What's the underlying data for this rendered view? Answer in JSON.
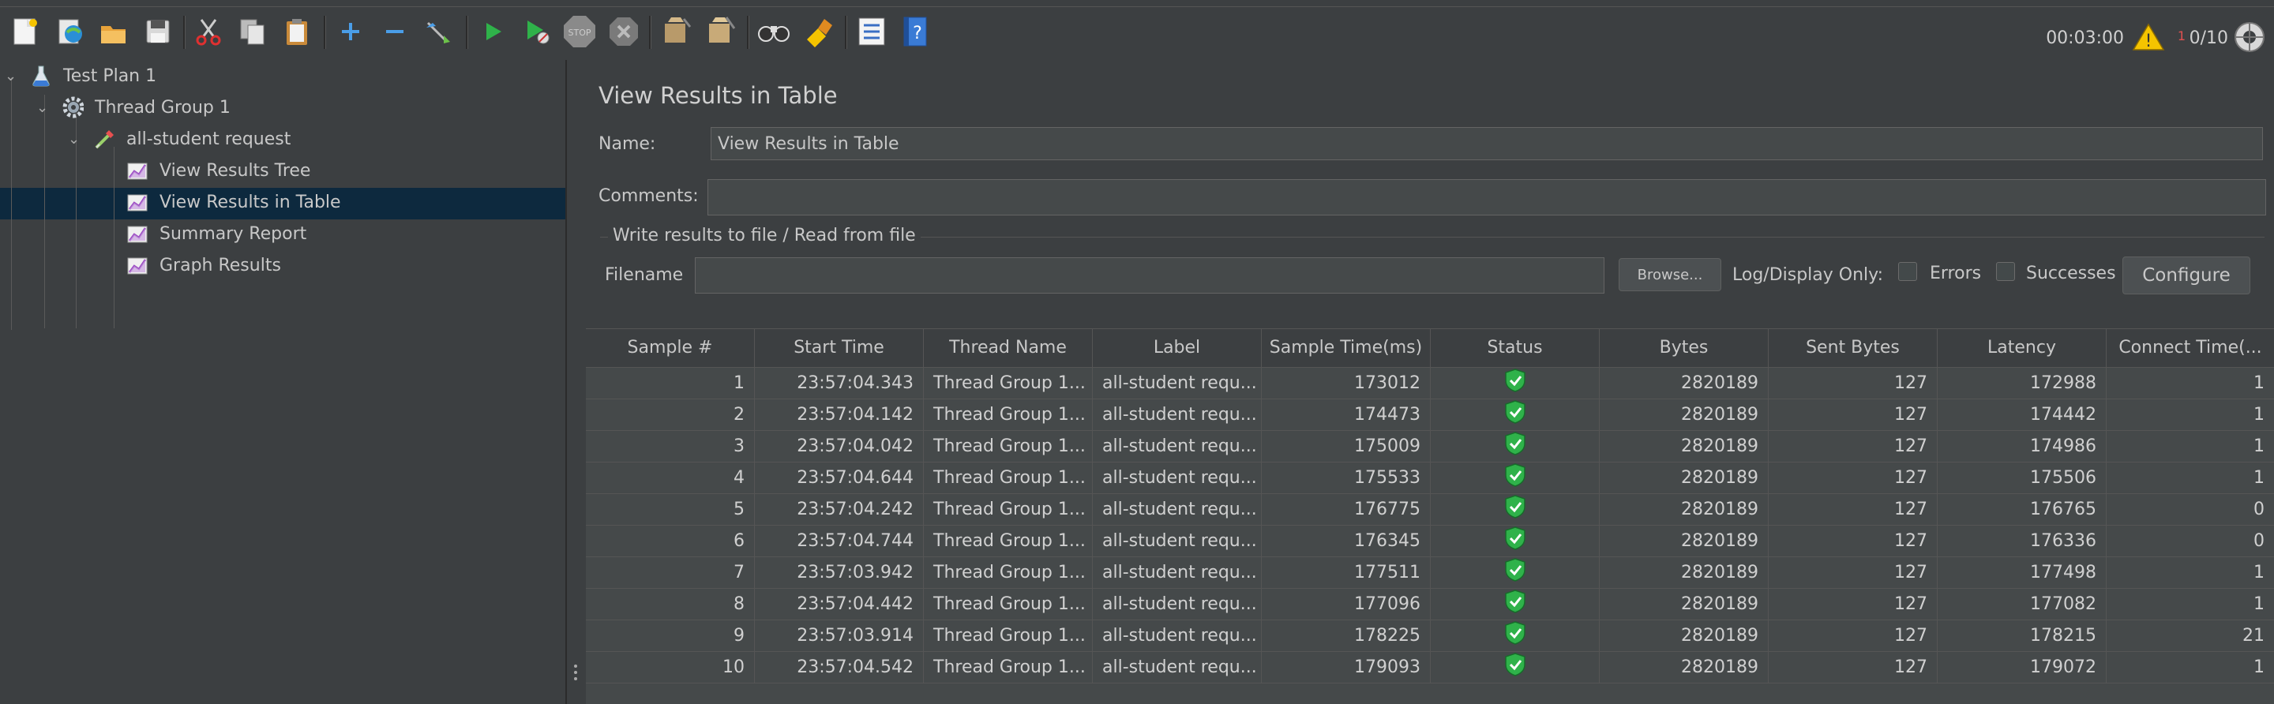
{
  "toolbar": {
    "timer": "00:03:00",
    "warning_count": "1",
    "threads": "0/10"
  },
  "tree": {
    "nodes": [
      {
        "label": "Test Plan 1",
        "icon": "flask-icon"
      },
      {
        "label": "Thread Group 1",
        "icon": "gear-icon"
      },
      {
        "label": "all-student request",
        "icon": "pipette-icon"
      },
      {
        "label": "View Results Tree",
        "icon": "graph-icon"
      },
      {
        "label": "View Results in Table",
        "icon": "graph-icon"
      },
      {
        "label": "Summary Report",
        "icon": "graph-icon"
      },
      {
        "label": "Graph Results",
        "icon": "graph-icon"
      }
    ],
    "selected": "View Results in Table"
  },
  "panel": {
    "title": "View Results in Table",
    "name_label": "Name:",
    "name_value": "View Results in Table",
    "comments_label": "Comments:",
    "comments_value": "",
    "file_section": "Write results to file / Read from file",
    "filename_label": "Filename",
    "filename_value": "",
    "browse_label": "Browse...",
    "log_display_label": "Log/Display Only:",
    "errors_label": "Errors",
    "successes_label": "Successes",
    "configure_label": "Configure"
  },
  "table": {
    "columns": [
      "Sample #",
      "Start Time",
      "Thread Name",
      "Label",
      "Sample Time(ms)",
      "Status",
      "Bytes",
      "Sent Bytes",
      "Latency",
      "Connect Time(..."
    ],
    "rows": [
      [
        "1",
        "23:57:04.343",
        "Thread Group 1...",
        "all-student requ...",
        "173012",
        "success",
        "2820189",
        "127",
        "172988",
        "1"
      ],
      [
        "2",
        "23:57:04.142",
        "Thread Group 1...",
        "all-student requ...",
        "174473",
        "success",
        "2820189",
        "127",
        "174442",
        "1"
      ],
      [
        "3",
        "23:57:04.042",
        "Thread Group 1...",
        "all-student requ...",
        "175009",
        "success",
        "2820189",
        "127",
        "174986",
        "1"
      ],
      [
        "4",
        "23:57:04.644",
        "Thread Group 1...",
        "all-student requ...",
        "175533",
        "success",
        "2820189",
        "127",
        "175506",
        "1"
      ],
      [
        "5",
        "23:57:04.242",
        "Thread Group 1...",
        "all-student requ...",
        "176775",
        "success",
        "2820189",
        "127",
        "176765",
        "0"
      ],
      [
        "6",
        "23:57:04.744",
        "Thread Group 1...",
        "all-student requ...",
        "176345",
        "success",
        "2820189",
        "127",
        "176336",
        "0"
      ],
      [
        "7",
        "23:57:03.942",
        "Thread Group 1...",
        "all-student requ...",
        "177511",
        "success",
        "2820189",
        "127",
        "177498",
        "1"
      ],
      [
        "8",
        "23:57:04.442",
        "Thread Group 1...",
        "all-student requ...",
        "177096",
        "success",
        "2820189",
        "127",
        "177082",
        "1"
      ],
      [
        "9",
        "23:57:03.914",
        "Thread Group 1...",
        "all-student requ...",
        "178225",
        "success",
        "2820189",
        "127",
        "178215",
        "21"
      ],
      [
        "10",
        "23:57:04.542",
        "Thread Group 1...",
        "all-student requ...",
        "179093",
        "success",
        "2820189",
        "127",
        "179072",
        "1"
      ]
    ]
  },
  "colors": {
    "background": "#3c3f41",
    "selection": "#0d293e",
    "status_ok": "#2fb24a"
  }
}
